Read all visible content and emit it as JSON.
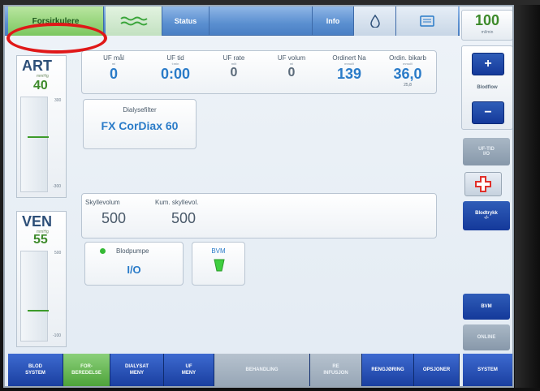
{
  "topbar": {
    "mode_label": "Forsirkulere",
    "status_label": "Status",
    "info_label": "Info"
  },
  "art": {
    "label": "ART",
    "unit": "mmHg",
    "value": "40",
    "scale_top": "300",
    "scale_bottom": "-300"
  },
  "ven": {
    "label": "VEN",
    "unit": "mmHg",
    "value": "55",
    "scale_top": "500",
    "scale_bottom": "-100"
  },
  "uf": [
    {
      "label": "UF mål",
      "sub": "ml",
      "value": "0"
    },
    {
      "label": "UF tid",
      "sub": "t:min",
      "value": "0:00"
    },
    {
      "label": "UF rate",
      "sub": "ml/t",
      "value": "0"
    },
    {
      "label": "UF volum",
      "sub": "ml",
      "value": "0"
    },
    {
      "label": "Ordinert Na",
      "sub": "mmol/l",
      "value": "139"
    },
    {
      "label": "Ordin. bikarb",
      "sub": "mmol/l",
      "value": "36,0",
      "extra": "25,8"
    }
  ],
  "filter": {
    "label": "Dialysefilter",
    "value": "FX CorDiax 60"
  },
  "rinse": {
    "label1": "Skyllevolum",
    "value1": "500",
    "label2": "Kum. skyllevol.",
    "value2": "500"
  },
  "pump": {
    "label": "Blodpumpe",
    "value": "I/O"
  },
  "bvm": {
    "label": "BVM"
  },
  "right": {
    "flow_value": "100",
    "flow_unit": "ml/min",
    "blodflow_label": "Blodflow",
    "uf_tid_label": "UF-TID",
    "uf_tid_value": "I/O",
    "bledtrykk_label": "Blodtrykk",
    "bledtrykk_value": "-/-",
    "bvm_button": "BVM",
    "online_button": "ONLINE"
  },
  "bottom": [
    {
      "line1": "BLOD",
      "line2": "SYSTEM",
      "style": "blue"
    },
    {
      "line1": "FOR-",
      "line2": "BEREDELSE",
      "style": "green"
    },
    {
      "line1": "DIALYSAT",
      "line2": "MENY",
      "style": "blue"
    },
    {
      "line1": "UF",
      "line2": "MENY",
      "style": "blue"
    },
    {
      "line1": "BEHANDLING",
      "line2": "",
      "style": "grey"
    },
    {
      "line1": "RE",
      "line2": "INFUSJON",
      "style": "grey"
    },
    {
      "line1": "RENGJØRING",
      "line2": "",
      "style": "blue"
    },
    {
      "line1": "OPSJONER",
      "line2": "",
      "style": "blue"
    },
    {
      "line1": "SYSTEM",
      "line2": "",
      "style": "blue"
    }
  ],
  "colors": {
    "accent_blue": "#2a7bc8",
    "active_green": "#7cc760",
    "highlight_red": "#e01818"
  }
}
